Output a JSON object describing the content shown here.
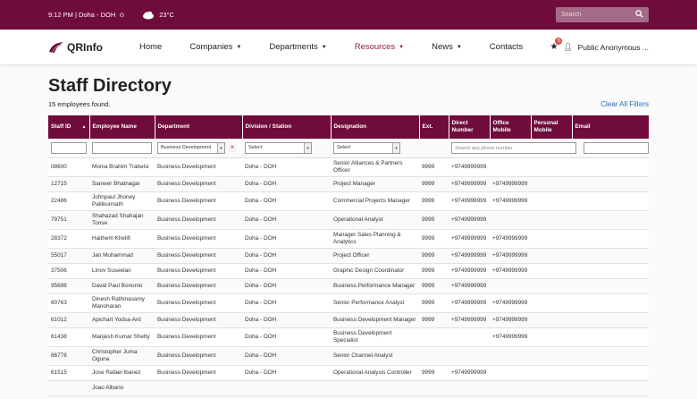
{
  "topbar": {
    "time_location": "9:12 PM | Doha - DOH",
    "temperature": "23°C",
    "search_placeholder": "Search"
  },
  "nav": {
    "logo_text": "QRInfo",
    "items": [
      {
        "label": "Home",
        "dropdown": false
      },
      {
        "label": "Companies",
        "dropdown": true
      },
      {
        "label": "Departments",
        "dropdown": true
      },
      {
        "label": "Resources",
        "dropdown": true,
        "active": true
      },
      {
        "label": "News",
        "dropdown": true
      },
      {
        "label": "Contacts",
        "dropdown": false
      }
    ],
    "notification_count": "5",
    "user_label": "Public Anonymous ..."
  },
  "page": {
    "title": "Staff Directory",
    "count_text": "15 employees found.",
    "clear_filters": "Clear All Filters"
  },
  "table": {
    "headers": [
      "Staff ID",
      "Employee Name",
      "Department",
      "Division / Station",
      "Designation",
      "Ext.",
      "Direct Number",
      "Office Mobile",
      "Personal Mobile",
      "Email"
    ],
    "filters": {
      "department_selected": "Business Development",
      "division_selected": "Select",
      "designation_selected": "Select",
      "phone_placeholder": "Search any phone number"
    },
    "rows": [
      [
        "08600",
        "Monia Brahim Trabelsi",
        "Business Development",
        "Doha - DOH",
        "Senior Alliances & Partners Officer",
        "9999",
        "+9749999999",
        "",
        "",
        ""
      ],
      [
        "12715",
        "Sameer Bhatnagar",
        "Business Development",
        "Doha - DOH",
        "Project Manager",
        "9999",
        "+9749999999",
        "+9749999999",
        "",
        ""
      ],
      [
        "22486",
        "Johnpaul Jhoney Pallikunnath",
        "Business Development",
        "Doha - DOH",
        "Commercial Projects Manager",
        "9999",
        "+9749999999",
        "+9749999999",
        "",
        ""
      ],
      [
        "79751",
        "Shahazad Shahajan Tonse",
        "Business Development",
        "Doha - DOH",
        "Operational Analyst",
        "9999",
        "+9749999999",
        "",
        "",
        ""
      ],
      [
        "28372",
        "Haithem Khelifi",
        "Business Development",
        "Doha - DOH",
        "Manager Sales Planning & Analytics",
        "9999",
        "+9749999999",
        "+9749999999",
        "",
        ""
      ],
      [
        "55017",
        "Jan Muhammad",
        "Business Development",
        "Doha - DOH",
        "Project Officer",
        "9999",
        "+9749999999",
        "+9749999999",
        "",
        ""
      ],
      [
        "37506",
        "Linov Suseelan",
        "Business Development",
        "Doha - DOH",
        "Graphic Design Coordinator",
        "9999",
        "+9749999999",
        "+9749999999",
        "",
        ""
      ],
      [
        "95698",
        "David Paul Bonomo",
        "Business Development",
        "Doha - DOH",
        "Business Performance Manager",
        "9999",
        "+9749999999",
        "",
        "",
        ""
      ],
      [
        "60763",
        "Dinesh Rathinasamy Manoharan",
        "Business Development",
        "Doha - DOH",
        "Senior Performance Analyst",
        "9999",
        "+9749999999",
        "+9749999999",
        "",
        ""
      ],
      [
        "61012",
        "Apichart Yodsa-Ard",
        "Business Development",
        "Doha - DOH",
        "Business Development Manager",
        "9999",
        "+9749999999",
        "+9749999999",
        "",
        ""
      ],
      [
        "61438",
        "Manjesh Kumar Shetty",
        "Business Development",
        "Doha - DOH",
        "Business Development Specialist",
        "",
        "",
        "+9749999999",
        "",
        ""
      ],
      [
        "86778",
        "Christopher Juma Oguna",
        "Business Development",
        "Doha - DOH",
        "Senior Channel Analyst",
        "",
        "",
        "",
        "",
        ""
      ],
      [
        "61515",
        "Jose Rafael Ibanez",
        "Business Development",
        "Doha - DOH",
        "Operational Analysis Controller",
        "9999",
        "+9749999999",
        "",
        "",
        ""
      ],
      [
        "",
        "Joao Albano",
        "",
        "",
        "",
        "",
        "",
        "",
        "",
        ""
      ]
    ]
  }
}
